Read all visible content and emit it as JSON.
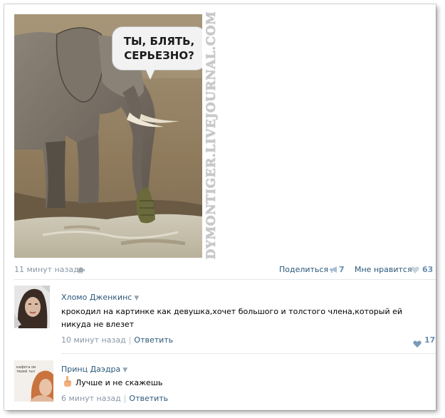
{
  "post": {
    "image_caption": "ТЫ, БЛЯТЬ,\nСЕРЬЕЗНО?",
    "watermark": "DYMONTIGER.LIVEJOURNAL.COM",
    "time": "11 минут назад",
    "share_label": "Поделиться",
    "share_count": "7",
    "like_label": "Мне нравится",
    "like_count": "63"
  },
  "comments": [
    {
      "author": "Хломо Дженкинс",
      "text": "крокодил на картинке как девушка,хочет большого и толстого члена,который ей никуда не влезет",
      "time": "10 минут назад",
      "separator": "|",
      "reply_label": "Ответить",
      "like_count": "17"
    },
    {
      "author": "Принц Даэдра",
      "text": "Лучше и не скажешь",
      "time": "6 минут назад",
      "separator": "|",
      "reply_label": "Ответить",
      "avatar_text": "кафета ои твоей тьп"
    }
  ],
  "colors": {
    "link": "#2b587a",
    "meta": "#8a98a8",
    "count": "#6b8db0"
  }
}
